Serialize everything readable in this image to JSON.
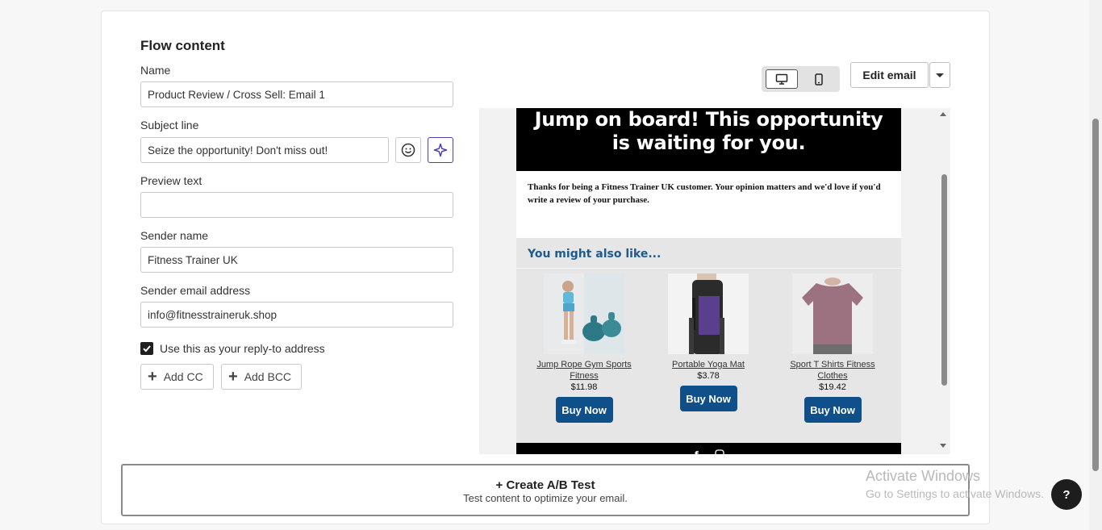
{
  "section": {
    "title": "Flow content"
  },
  "fields": {
    "name": {
      "label": "Name",
      "value": "Product Review / Cross Sell: Email 1"
    },
    "subject": {
      "label": "Subject line",
      "value": "Seize the opportunity! Don't miss out!"
    },
    "preview": {
      "label": "Preview text",
      "value": ""
    },
    "sender_name": {
      "label": "Sender name",
      "value": "Fitness Trainer UK"
    },
    "sender_email": {
      "label": "Sender email address",
      "value": "info@fitnesstraineruk.shop"
    }
  },
  "reply_to": {
    "label": "Use this as your reply-to address",
    "checked": true
  },
  "buttons": {
    "add_cc": "Add CC",
    "add_bcc": "Add BCC",
    "edit_email": "Edit email"
  },
  "email_preview": {
    "hero_line1": "Jump on board! This opportunity",
    "hero_line2": "is waiting for you.",
    "thanks": "Thanks for being a Fitness Trainer UK customer. Your opinion matters and we'd love if you'd write a review of your purchase.",
    "also_title": "You might also like...",
    "products": [
      {
        "name": "Jump Rope Gym Sports Fitness",
        "price": "$11.98",
        "cta": "Buy Now"
      },
      {
        "name": "Portable Yoga Mat",
        "price": "$3.78",
        "cta": "Buy Now"
      },
      {
        "name": "Sport T Shirts Fitness Clothes",
        "price": "$19.42",
        "cta": "Buy Now"
      }
    ]
  },
  "ab_test": {
    "title": "+ Create A/B Test",
    "subtitle": "Test content to optimize your email."
  },
  "watermark": {
    "line1": "Activate Windows",
    "line2": "Go to Settings to activate Windows."
  },
  "help": {
    "label": "?"
  },
  "colors": {
    "accent_purple": "#4b3fa8",
    "buy_button": "#0f4f8a",
    "also_title": "#1e5a8c"
  }
}
